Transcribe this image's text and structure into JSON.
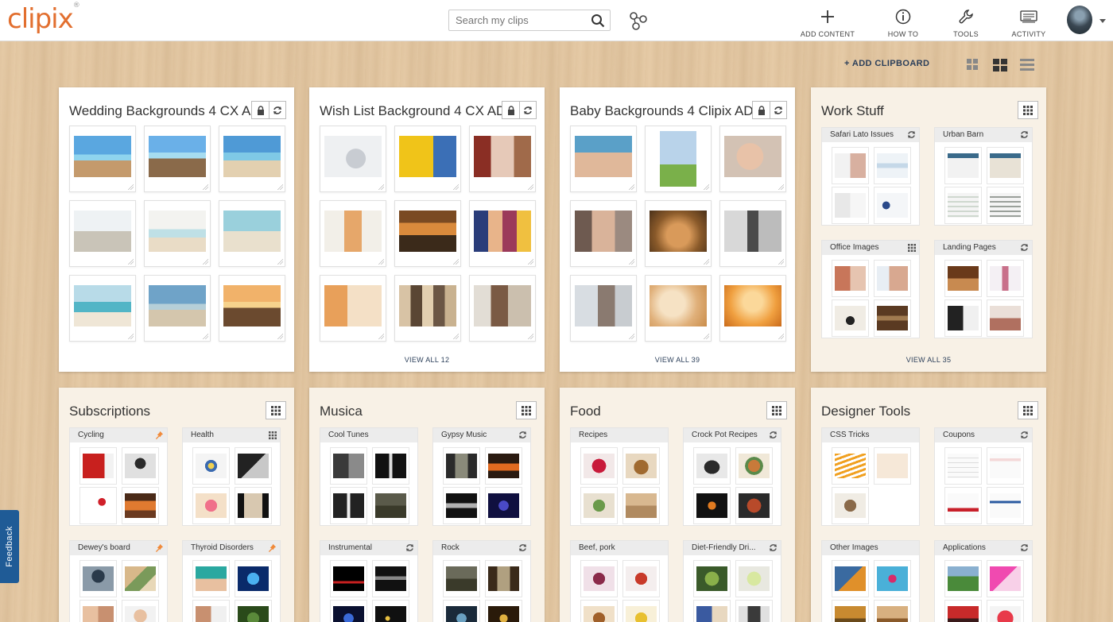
{
  "app": {
    "logo": "clipix",
    "logo_mark": "®"
  },
  "search": {
    "placeholder": "Search my clips"
  },
  "nav": {
    "add_content": "ADD CONTENT",
    "how_to": "HOW TO",
    "tools": "TOOLS",
    "activity": "ACTIVITY"
  },
  "toolbar": {
    "add_clipboard": "+ ADD CLIPBOARD"
  },
  "boards": [
    {
      "title": "Wedding Backgrounds 4 CX AD",
      "view_all": ""
    },
    {
      "title": "Wish List Background 4 CX AD",
      "view_all": "VIEW ALL 12"
    },
    {
      "title": "Baby Backgrounds 4 Clipix AD",
      "view_all": "VIEW ALL 39"
    },
    {
      "title": "Work Stuff",
      "view_all": "VIEW ALL 35",
      "subs": [
        "Safari Lato Issues",
        "Urban Barn",
        "Office Images",
        "Landing Pages"
      ]
    },
    {
      "title": "Subscriptions",
      "subs": [
        "Cycling",
        "Health",
        "Dewey's board",
        "Thyroid Disorders"
      ]
    },
    {
      "title": "Musica",
      "subs": [
        "Cool Tunes",
        "Gypsy Music",
        "Instrumental",
        "Rock"
      ]
    },
    {
      "title": "Food",
      "subs": [
        "Recipes",
        "Crock Pot Recipes",
        "Beef, pork",
        "Diet-Friendly Dri..."
      ]
    },
    {
      "title": "Designer Tools",
      "subs": [
        "CSS Tricks",
        "Coupons",
        "Other Images",
        "Applications"
      ]
    }
  ],
  "feedback": "Feedback",
  "colors": {
    "brand": "#e26f2f",
    "link": "#2b3f5a",
    "feedback": "#1f5b96"
  }
}
